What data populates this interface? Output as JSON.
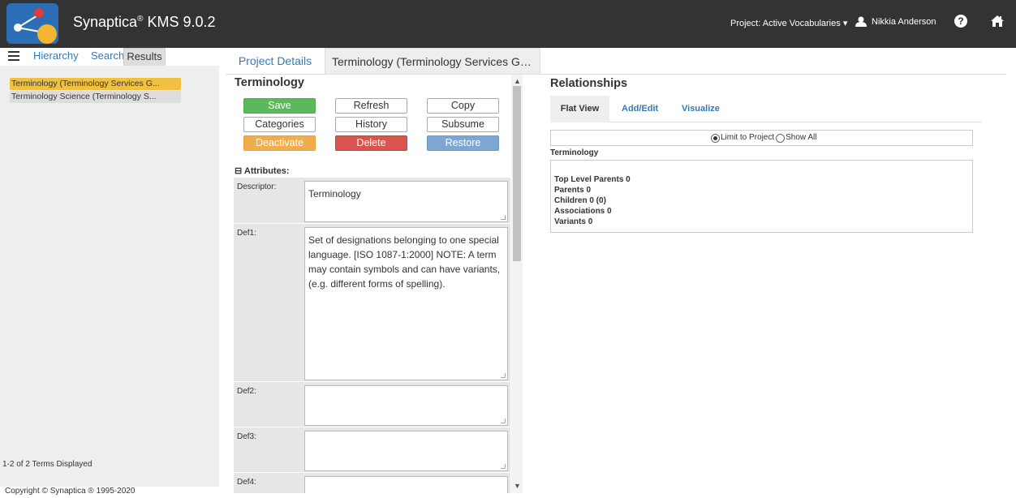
{
  "header": {
    "app_name": "Synaptica",
    "registered": "®",
    "version": "KMS 9.0.2",
    "project_label": "Project: Active Vocabularies",
    "user_name": "Nikkia Anderson",
    "help_glyph": "?"
  },
  "left": {
    "tabs": {
      "hierarchy": "Hierarchy",
      "search": "Search",
      "results": "Results"
    },
    "results": [
      "Terminology (Terminology Services G...",
      "Terminology Science (Terminology S..."
    ],
    "count_text": "1-2 of 2 Terms Displayed",
    "copyright": "Copyright © Synaptica ® 1995-2020"
  },
  "middle": {
    "tabs": {
      "project_details": "Project Details",
      "term_tab": "Terminology (Terminology Services Glo..."
    },
    "term_heading": "Terminology",
    "buttons": {
      "save": "Save",
      "refresh": "Refresh",
      "copy": "Copy",
      "categories": "Categories",
      "history": "History",
      "subsume": "Subsume",
      "deactivate": "Deactivate",
      "delete": "Delete",
      "restore": "Restore"
    },
    "attributes_header": "Attributes:",
    "attributes": [
      {
        "label": "Descriptor:",
        "value": "Terminology"
      },
      {
        "label": "Def1:",
        "value": "Set of designations belonging to one special language. [ISO 1087-1:2000] NOTE: A term may contain symbols and can have variants, (e.g. different forms of spelling)."
      },
      {
        "label": "Def2:",
        "value": ""
      },
      {
        "label": "Def3:",
        "value": ""
      },
      {
        "label": "Def4:",
        "value": ""
      }
    ]
  },
  "relationships": {
    "heading": "Relationships",
    "tabs": {
      "flat": "Flat View",
      "add_edit": "Add/Edit",
      "visualize": "Visualize"
    },
    "limit_label": "Limit to Project",
    "show_all_label": "Show All",
    "term": "Terminology",
    "lines": {
      "top_level_parents": "Top Level Parents  0",
      "parents": "Parents  0",
      "children": "Children  0  (0)",
      "associations": "Associations  0",
      "variants": "Variants  0"
    }
  },
  "colors": {
    "topbar": "#333333",
    "selected_term": "#f0c040",
    "save": "#5cb85c",
    "deactivate": "#f0ad4e",
    "delete": "#d9534f",
    "restore": "#7ea6d2",
    "link": "#337ab7"
  }
}
